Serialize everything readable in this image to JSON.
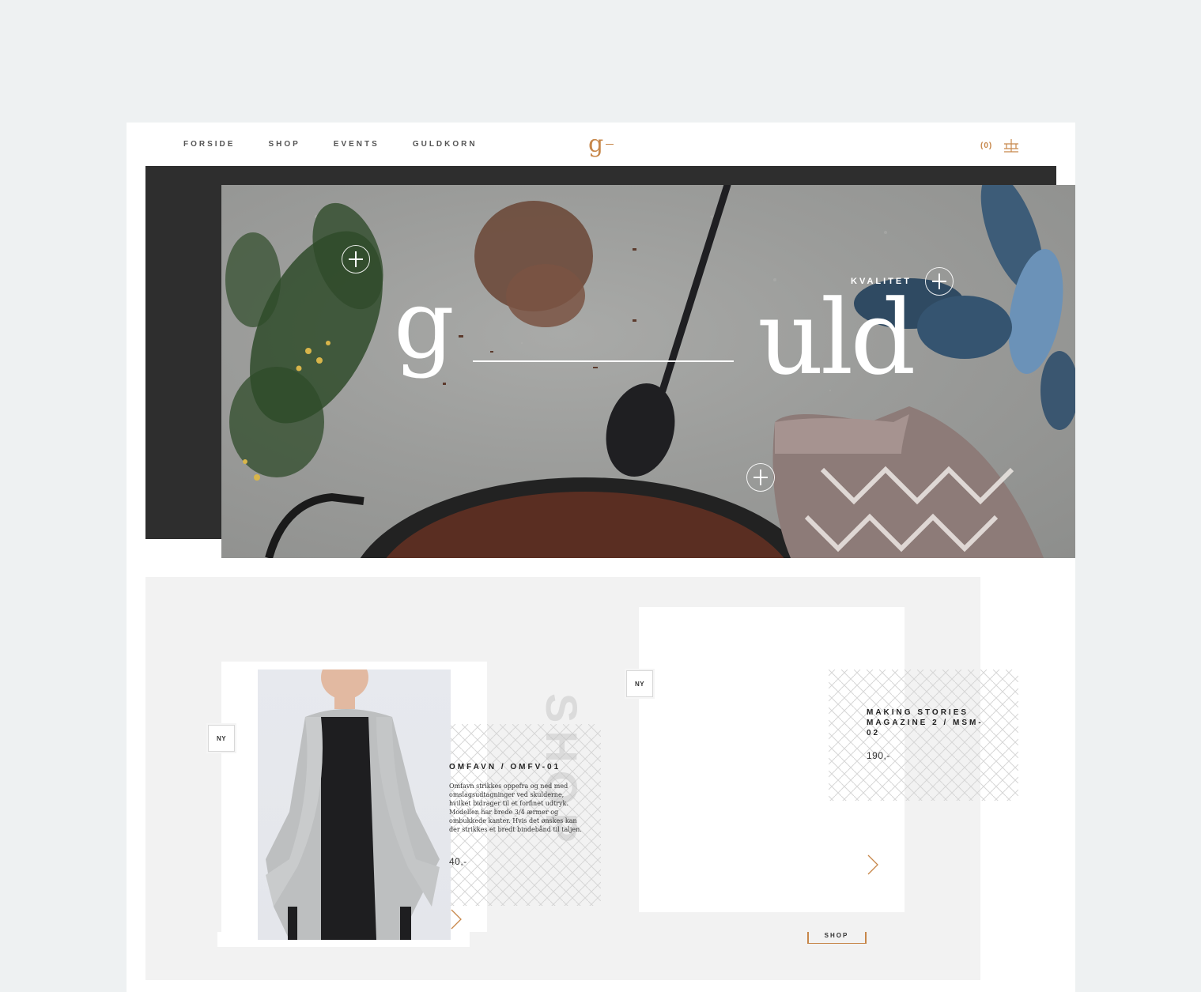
{
  "nav": {
    "items": [
      "FORSIDE",
      "SHOP",
      "EVENTS",
      "GULDKORN"
    ]
  },
  "logo": {
    "letter": "g"
  },
  "cart": {
    "count": "(0)"
  },
  "hero": {
    "badge_label": "KVALITET",
    "word_left": "g",
    "word_right": "uld"
  },
  "shop": {
    "vertical_label": "SHOP",
    "link_label": "SHOP",
    "products": [
      {
        "badge": "NY",
        "title": "OMFAVN / OMFV-01",
        "description": "Omfavn strikkes oppefra og ned med omslagsudtagninger ved skulderne, hvilket bidrager til et forfinet udtryk. Modellen har brede 3/4 ærmer og ombukkede kanter. Hvis det ønskes kan der strikkes et bredt bindebånd til taljen.",
        "price": "40,-"
      },
      {
        "badge": "NY",
        "title": "MAKING STORIES MAGAZINE 2 / MSM-02",
        "price": "190,-"
      }
    ]
  },
  "colors": {
    "accent": "#c7874a",
    "page_bg": "#eef1f2",
    "dark_panel": "#2e2e2e",
    "section_bg": "#f2f2f2"
  },
  "icons": [
    "cart-icon",
    "plus-circle-icon",
    "chevron-right-icon"
  ]
}
